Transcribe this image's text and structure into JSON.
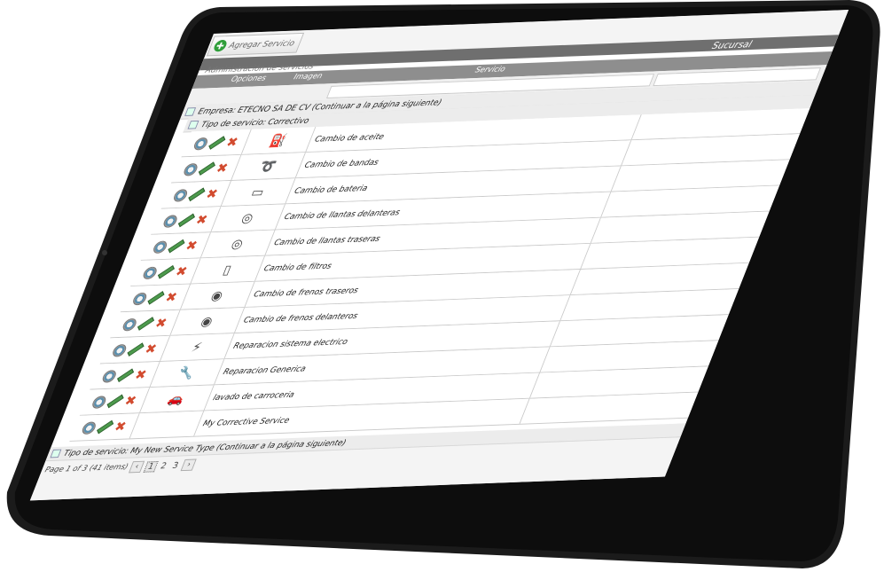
{
  "toolbar": {
    "add_label": "Agregar Servicio"
  },
  "page": {
    "title": "Administración de servicios"
  },
  "columns": {
    "opciones": "Opciones",
    "imagen": "Imagen",
    "servicio": "Servicio",
    "sucursal": "Sucursal"
  },
  "groups": {
    "empresa": "Empresa: ETECNO SA DE CV (Continuar a la página siguiente)",
    "tipo1": "Tipo de servicio: Correctivo",
    "tipo2": "Tipo de servicio: My New Service Type (Continuar a la página siguiente)"
  },
  "services": [
    {
      "name": "Cambio de aceite",
      "icon": "⛽"
    },
    {
      "name": "Cambio de bandas",
      "icon": "➰"
    },
    {
      "name": "Cambio de bateria",
      "icon": "▭"
    },
    {
      "name": "Cambio de llantas delanteras",
      "icon": "◎"
    },
    {
      "name": "Cambio de llantas traseras",
      "icon": "◎"
    },
    {
      "name": "Cambio de filtros",
      "icon": "▯"
    },
    {
      "name": "Cambio de frenos traseros",
      "icon": "◉"
    },
    {
      "name": "Cambio de frenos delanteros",
      "icon": "◉"
    },
    {
      "name": "Reparacion sistema electrico",
      "icon": "⚡"
    },
    {
      "name": "Reparacion Generica",
      "icon": "🔧"
    },
    {
      "name": "lavado de carroceria",
      "icon": "🚗"
    },
    {
      "name": "My Corrective Service",
      "icon": ""
    }
  ],
  "pager": {
    "summary": "Page 1 of 3 (41 items)",
    "pages": [
      "1",
      "2",
      "3"
    ],
    "current": "1"
  },
  "colors": {
    "delete": "#d24b2f",
    "add": "#2f9e3a",
    "header": "#6f6f6f"
  }
}
